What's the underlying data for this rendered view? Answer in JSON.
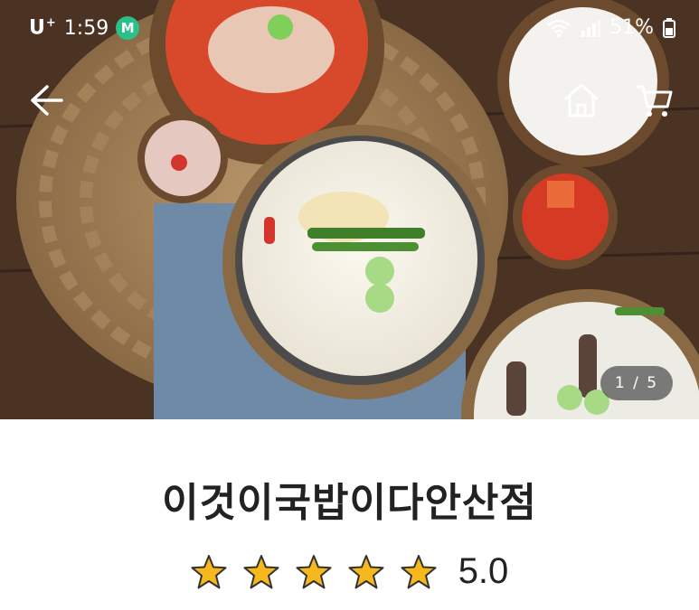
{
  "status_bar": {
    "carrier": "U",
    "carrier_sup": "+",
    "time": "1:59",
    "app_badge": "M",
    "battery": "51%"
  },
  "icons": {
    "back": "arrow-left-icon",
    "home": "home-icon",
    "cart": "cart-icon"
  },
  "gallery": {
    "indicator": "1 / 5"
  },
  "store": {
    "name": "이것이국밥이다안산점",
    "rating": "5.0",
    "rating_value": 5.0,
    "star_count": 5,
    "star_color": "#f6b81d"
  }
}
